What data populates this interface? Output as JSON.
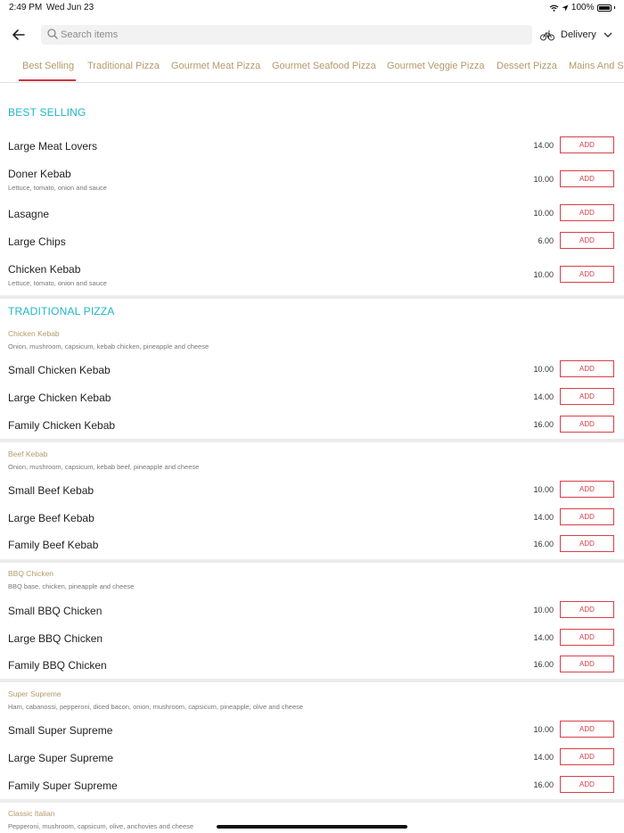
{
  "status_bar": {
    "time": "2:49 PM",
    "date": "Wed Jun 23",
    "battery": "100%"
  },
  "search": {
    "placeholder": "Search items"
  },
  "delivery": {
    "label": "Delivery"
  },
  "tabs": [
    "Best Selling",
    "Traditional Pizza",
    "Gourmet Meat Pizza",
    "Gourmet Seafood Pizza",
    "Gourmet Veggie Pizza",
    "Dessert Pizza",
    "Mains And Si"
  ],
  "active_tab": "Best Selling",
  "add_label": "ADD",
  "best_selling": {
    "title": "BEST SELLING",
    "items": [
      {
        "name": "Large Meat Lovers",
        "desc": "",
        "price": "14.00"
      },
      {
        "name": "Doner Kebab",
        "desc": "Lettuce, tomato, onion and sauce",
        "price": "10.00"
      },
      {
        "name": "Lasagne",
        "desc": "",
        "price": "10.00"
      },
      {
        "name": "Large Chips",
        "desc": "",
        "price": "6.00"
      },
      {
        "name": "Chicken Kebab",
        "desc": "Lettuce, tomato, onion and sauce",
        "price": "10.00"
      }
    ]
  },
  "traditional_pizza": {
    "title": "TRADITIONAL PIZZA",
    "groups": [
      {
        "name": "Chicken Kebab",
        "desc": "Onion, mushroom, capsicum, kebab chicken, pineapple and cheese",
        "items": [
          {
            "name": "Small Chicken Kebab",
            "price": "10.00"
          },
          {
            "name": "Large Chicken Kebab",
            "price": "14.00"
          },
          {
            "name": "Family Chicken Kebab",
            "price": "16.00"
          }
        ]
      },
      {
        "name": "Beef Kebab",
        "desc": "Onion, mushroom, capsicum, kebab beef, pineapple and cheese",
        "items": [
          {
            "name": "Small Beef Kebab",
            "price": "10.00"
          },
          {
            "name": "Large Beef Kebab",
            "price": "14.00"
          },
          {
            "name": "Family Beef Kebab",
            "price": "16.00"
          }
        ]
      },
      {
        "name": "BBQ Chicken",
        "desc": "BBQ base, chicken, pineapple and cheese",
        "items": [
          {
            "name": "Small BBQ Chicken",
            "price": "10.00"
          },
          {
            "name": "Large BBQ Chicken",
            "price": "14.00"
          },
          {
            "name": "Family BBQ Chicken",
            "price": "16.00"
          }
        ]
      },
      {
        "name": "Super Supreme",
        "desc": "Ham, cabanossi, pepperoni, diced bacon, onion, mushroom, capsicum, pineapple, olive and cheese",
        "items": [
          {
            "name": "Small Super Supreme",
            "price": "10.00"
          },
          {
            "name": "Large Super Supreme",
            "price": "14.00"
          },
          {
            "name": "Family Super Supreme",
            "price": "16.00"
          }
        ]
      },
      {
        "name": "Classic Italian",
        "desc": "Pepperoni, mushroom, capsicum, olive, anchovies and cheese",
        "items": []
      }
    ]
  },
  "colors": {
    "accent_teal": "#1fb6c6",
    "accent_red": "#d8404a",
    "tab_gold": "#b39a6b"
  },
  "icons": {
    "back": "arrow-left-icon",
    "search": "search-icon",
    "delivery": "bicycle-icon",
    "dropdown": "chevron-down-icon"
  }
}
